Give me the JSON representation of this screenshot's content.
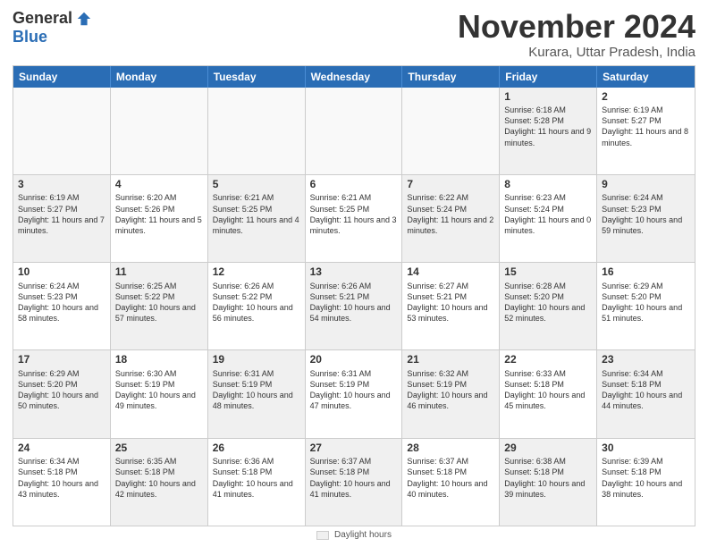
{
  "logo": {
    "general": "General",
    "blue": "Blue"
  },
  "header": {
    "month": "November 2024",
    "location": "Kurara, Uttar Pradesh, India"
  },
  "weekdays": [
    "Sunday",
    "Monday",
    "Tuesday",
    "Wednesday",
    "Thursday",
    "Friday",
    "Saturday"
  ],
  "footer": {
    "label": "Daylight hours"
  },
  "rows": [
    [
      {
        "day": "",
        "text": "",
        "empty": true
      },
      {
        "day": "",
        "text": "",
        "empty": true
      },
      {
        "day": "",
        "text": "",
        "empty": true
      },
      {
        "day": "",
        "text": "",
        "empty": true
      },
      {
        "day": "",
        "text": "",
        "empty": true
      },
      {
        "day": "1",
        "text": "Sunrise: 6:18 AM\nSunset: 5:28 PM\nDaylight: 11 hours and 9 minutes.",
        "shaded": true
      },
      {
        "day": "2",
        "text": "Sunrise: 6:19 AM\nSunset: 5:27 PM\nDaylight: 11 hours and 8 minutes.",
        "shaded": false
      }
    ],
    [
      {
        "day": "3",
        "text": "Sunrise: 6:19 AM\nSunset: 5:27 PM\nDaylight: 11 hours and 7 minutes.",
        "shaded": true
      },
      {
        "day": "4",
        "text": "Sunrise: 6:20 AM\nSunset: 5:26 PM\nDaylight: 11 hours and 5 minutes.",
        "shaded": false
      },
      {
        "day": "5",
        "text": "Sunrise: 6:21 AM\nSunset: 5:25 PM\nDaylight: 11 hours and 4 minutes.",
        "shaded": true
      },
      {
        "day": "6",
        "text": "Sunrise: 6:21 AM\nSunset: 5:25 PM\nDaylight: 11 hours and 3 minutes.",
        "shaded": false
      },
      {
        "day": "7",
        "text": "Sunrise: 6:22 AM\nSunset: 5:24 PM\nDaylight: 11 hours and 2 minutes.",
        "shaded": true
      },
      {
        "day": "8",
        "text": "Sunrise: 6:23 AM\nSunset: 5:24 PM\nDaylight: 11 hours and 0 minutes.",
        "shaded": false
      },
      {
        "day": "9",
        "text": "Sunrise: 6:24 AM\nSunset: 5:23 PM\nDaylight: 10 hours and 59 minutes.",
        "shaded": true
      }
    ],
    [
      {
        "day": "10",
        "text": "Sunrise: 6:24 AM\nSunset: 5:23 PM\nDaylight: 10 hours and 58 minutes.",
        "shaded": false
      },
      {
        "day": "11",
        "text": "Sunrise: 6:25 AM\nSunset: 5:22 PM\nDaylight: 10 hours and 57 minutes.",
        "shaded": true
      },
      {
        "day": "12",
        "text": "Sunrise: 6:26 AM\nSunset: 5:22 PM\nDaylight: 10 hours and 56 minutes.",
        "shaded": false
      },
      {
        "day": "13",
        "text": "Sunrise: 6:26 AM\nSunset: 5:21 PM\nDaylight: 10 hours and 54 minutes.",
        "shaded": true
      },
      {
        "day": "14",
        "text": "Sunrise: 6:27 AM\nSunset: 5:21 PM\nDaylight: 10 hours and 53 minutes.",
        "shaded": false
      },
      {
        "day": "15",
        "text": "Sunrise: 6:28 AM\nSunset: 5:20 PM\nDaylight: 10 hours and 52 minutes.",
        "shaded": true
      },
      {
        "day": "16",
        "text": "Sunrise: 6:29 AM\nSunset: 5:20 PM\nDaylight: 10 hours and 51 minutes.",
        "shaded": false
      }
    ],
    [
      {
        "day": "17",
        "text": "Sunrise: 6:29 AM\nSunset: 5:20 PM\nDaylight: 10 hours and 50 minutes.",
        "shaded": true
      },
      {
        "day": "18",
        "text": "Sunrise: 6:30 AM\nSunset: 5:19 PM\nDaylight: 10 hours and 49 minutes.",
        "shaded": false
      },
      {
        "day": "19",
        "text": "Sunrise: 6:31 AM\nSunset: 5:19 PM\nDaylight: 10 hours and 48 minutes.",
        "shaded": true
      },
      {
        "day": "20",
        "text": "Sunrise: 6:31 AM\nSunset: 5:19 PM\nDaylight: 10 hours and 47 minutes.",
        "shaded": false
      },
      {
        "day": "21",
        "text": "Sunrise: 6:32 AM\nSunset: 5:19 PM\nDaylight: 10 hours and 46 minutes.",
        "shaded": true
      },
      {
        "day": "22",
        "text": "Sunrise: 6:33 AM\nSunset: 5:18 PM\nDaylight: 10 hours and 45 minutes.",
        "shaded": false
      },
      {
        "day": "23",
        "text": "Sunrise: 6:34 AM\nSunset: 5:18 PM\nDaylight: 10 hours and 44 minutes.",
        "shaded": true
      }
    ],
    [
      {
        "day": "24",
        "text": "Sunrise: 6:34 AM\nSunset: 5:18 PM\nDaylight: 10 hours and 43 minutes.",
        "shaded": false
      },
      {
        "day": "25",
        "text": "Sunrise: 6:35 AM\nSunset: 5:18 PM\nDaylight: 10 hours and 42 minutes.",
        "shaded": true
      },
      {
        "day": "26",
        "text": "Sunrise: 6:36 AM\nSunset: 5:18 PM\nDaylight: 10 hours and 41 minutes.",
        "shaded": false
      },
      {
        "day": "27",
        "text": "Sunrise: 6:37 AM\nSunset: 5:18 PM\nDaylight: 10 hours and 41 minutes.",
        "shaded": true
      },
      {
        "day": "28",
        "text": "Sunrise: 6:37 AM\nSunset: 5:18 PM\nDaylight: 10 hours and 40 minutes.",
        "shaded": false
      },
      {
        "day": "29",
        "text": "Sunrise: 6:38 AM\nSunset: 5:18 PM\nDaylight: 10 hours and 39 minutes.",
        "shaded": true
      },
      {
        "day": "30",
        "text": "Sunrise: 6:39 AM\nSunset: 5:18 PM\nDaylight: 10 hours and 38 minutes.",
        "shaded": false
      }
    ]
  ]
}
